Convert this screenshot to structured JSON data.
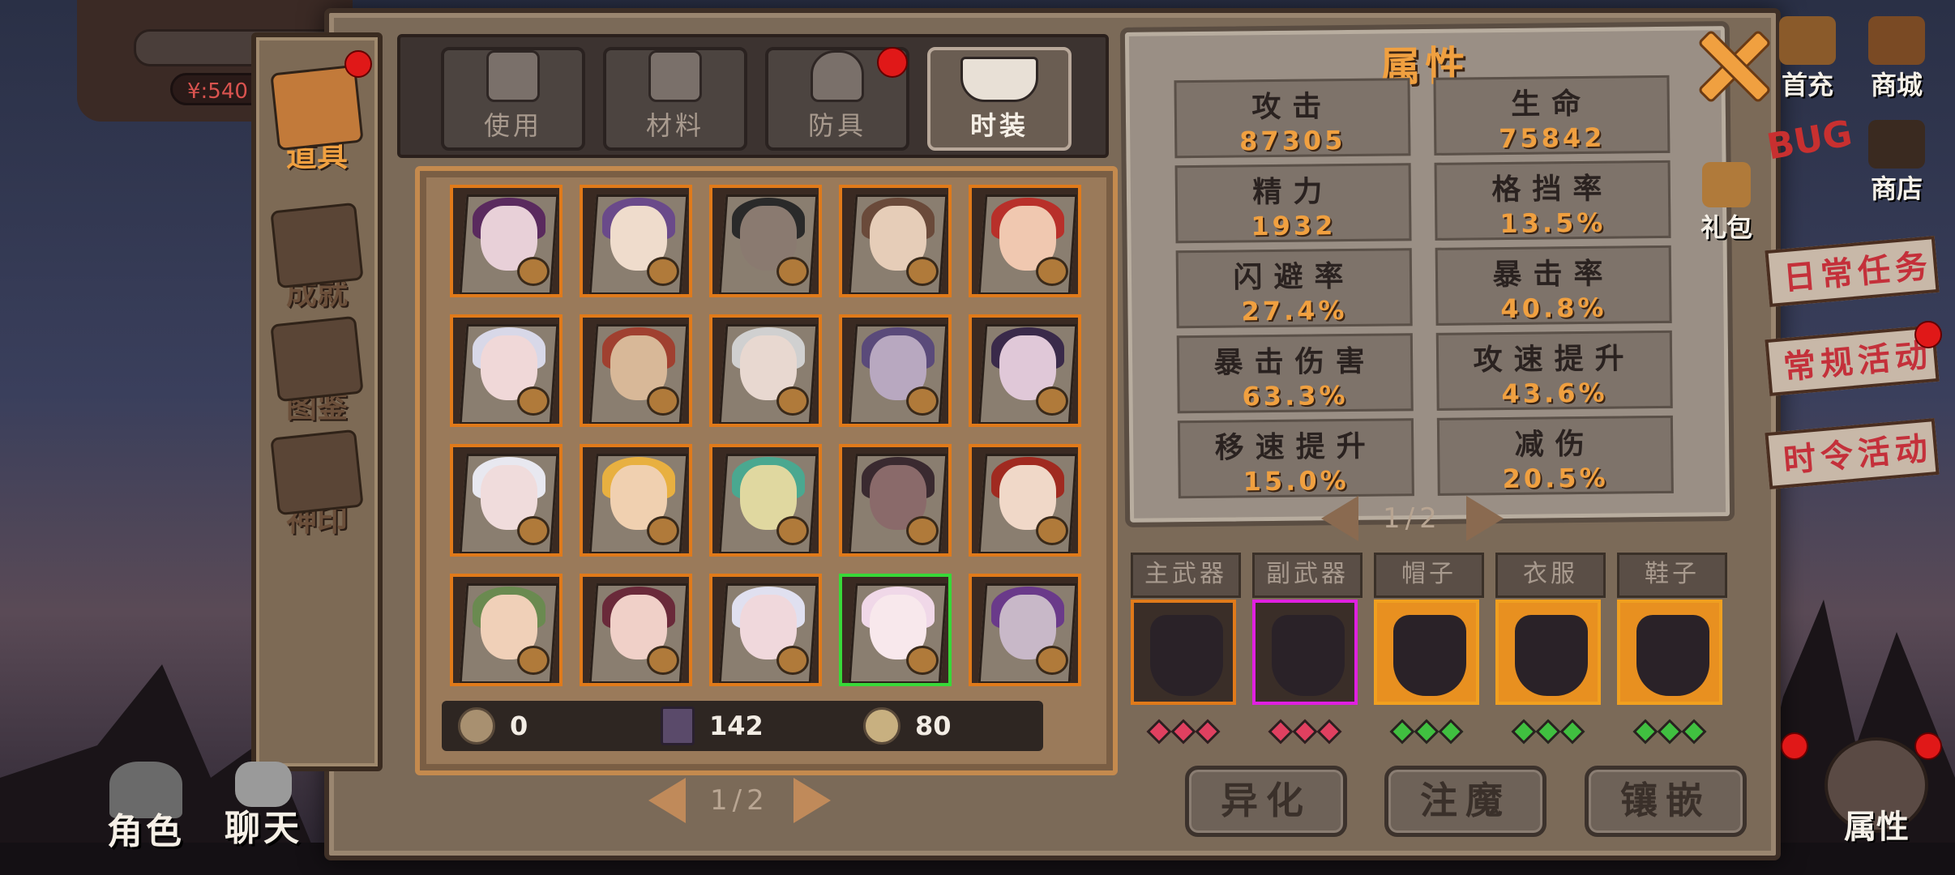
{
  "top_left": {
    "resource_text": "¥:540"
  },
  "side_tabs": [
    {
      "label": "道具",
      "active": true
    },
    {
      "label": "成就",
      "active": false
    },
    {
      "label": "图鉴",
      "active": false
    },
    {
      "label": "神印",
      "active": false
    }
  ],
  "category_tabs": [
    {
      "label": "使用",
      "icon": "potion-icon",
      "active": false
    },
    {
      "label": "材料",
      "icon": "material-icon",
      "active": false
    },
    {
      "label": "防具",
      "icon": "helmet-icon",
      "active": false
    },
    {
      "label": "时装",
      "icon": "hat-icon",
      "active": true
    }
  ],
  "items": [
    {
      "hair": "#5a2a5e",
      "face": "#e8d0d8"
    },
    {
      "hair": "#6a4a8a",
      "face": "#efdccc"
    },
    {
      "hair": "#2a2a2a",
      "face": "#8a7a70"
    },
    {
      "hair": "#6a4a3a",
      "face": "#e6cdb8"
    },
    {
      "hair": "#b8302a",
      "face": "#f0c8b0"
    },
    {
      "hair": "#d8d8e8",
      "face": "#f0d8d8"
    },
    {
      "hair": "#a04030",
      "face": "#d8b898"
    },
    {
      "hair": "#d0d0d0",
      "face": "#e8d8d0"
    },
    {
      "hair": "#5a4a7a",
      "face": "#b8a8c0"
    },
    {
      "hair": "#3a2a4a",
      "face": "#e0c8d8"
    },
    {
      "hair": "#e8e8f0",
      "face": "#f0dcdc"
    },
    {
      "hair": "#e8b040",
      "face": "#f0d0b0"
    },
    {
      "hair": "#4aa890",
      "face": "#e0d8a0"
    },
    {
      "hair": "#3a2a30",
      "face": "#8a6a6a"
    },
    {
      "hair": "#a02a20",
      "face": "#f0d8c8"
    },
    {
      "hair": "#6a8a50",
      "face": "#f0d0b8"
    },
    {
      "hair": "#6a2a3a",
      "face": "#f0d0c8"
    },
    {
      "hair": "#e0e0f0",
      "face": "#f0d8dc"
    },
    {
      "hair": "#f0d8e8",
      "face": "#f8e8ec"
    },
    {
      "hair": "#6a3a8a",
      "face": "#c8b8c8"
    }
  ],
  "currencies": [
    {
      "icon": "coin-icon",
      "value": "0"
    },
    {
      "icon": "book-icon",
      "value": "142"
    },
    {
      "icon": "medal-icon",
      "value": "80"
    }
  ],
  "items_pager": {
    "text": "1/2"
  },
  "attributes": {
    "title": "属性",
    "stats": [
      {
        "name": "攻击",
        "value": "87305"
      },
      {
        "name": "生命",
        "value": "75842"
      },
      {
        "name": "精力",
        "value": "1932"
      },
      {
        "name": "格挡率",
        "value": "13.5%"
      },
      {
        "name": "闪避率",
        "value": "27.4%"
      },
      {
        "name": "暴击率",
        "value": "40.8%"
      },
      {
        "name": "暴击伤害",
        "value": "63.3%"
      },
      {
        "name": "攻速提升",
        "value": "43.6%"
      },
      {
        "name": "移速提升",
        "value": "15.0%"
      },
      {
        "name": "减伤",
        "value": "20.5%"
      }
    ],
    "pager": {
      "text": "1/2"
    }
  },
  "equipment": [
    {
      "label": "主武器",
      "border": "#e07a1a",
      "bg": "#3a2e28",
      "dots": "#e04060"
    },
    {
      "label": "副武器",
      "border": "#e020e0",
      "bg": "#3a2e28",
      "dots": "#e04060"
    },
    {
      "label": "帽子",
      "border": "#f0a020",
      "bg": "#e89020",
      "dots": "#40c040"
    },
    {
      "label": "衣服",
      "border": "#f0a020",
      "bg": "#e89020",
      "dots": "#40c040"
    },
    {
      "label": "鞋子",
      "border": "#f0a020",
      "bg": "#e89020",
      "dots": "#40c040"
    }
  ],
  "actions": [
    {
      "label": "异化"
    },
    {
      "label": "注魔"
    },
    {
      "label": "镶嵌"
    }
  ],
  "right_menu": {
    "shop_label": "商城",
    "store_label": "商店",
    "gift_label": "礼包",
    "top_partial_label": "首充",
    "daily_task": "日常任务",
    "regular_event": "常规活动",
    "seasonal_event": "时令活动",
    "attr_button": "属性",
    "bug_label": "BUG"
  },
  "bottom_left": {
    "role": "角色",
    "chat": "聊天"
  }
}
